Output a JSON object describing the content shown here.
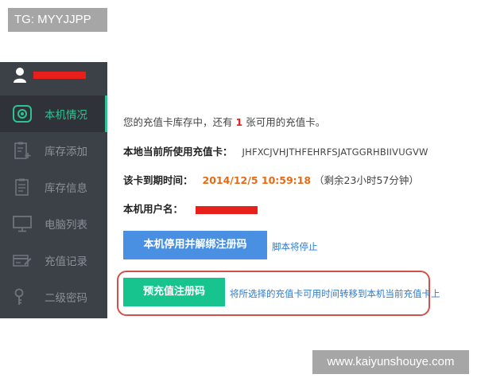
{
  "watermarks": {
    "top_tag": "TG: MYYJJPP",
    "bottom_tag": "www.kaiyunshouye.com"
  },
  "sidebar": {
    "items": [
      {
        "label": "本机情况",
        "icon": "device-icon",
        "active": true
      },
      {
        "label": "库存添加",
        "icon": "clipboard-add-icon",
        "active": false
      },
      {
        "label": "库存信息",
        "icon": "clipboard-list-icon",
        "active": false
      },
      {
        "label": "电脑列表",
        "icon": "monitor-icon",
        "active": false
      },
      {
        "label": "充值记录",
        "icon": "card-edit-icon",
        "active": false
      },
      {
        "label": "二级密码",
        "icon": "key-icon",
        "active": false
      }
    ]
  },
  "main": {
    "inventory_prefix": "您的充值卡库存中，还有",
    "inventory_count": "1",
    "inventory_suffix": "张可用的充值卡。",
    "current_card_label": "本地当前所使用充值卡：",
    "current_card_value": "JHFXCJVHJTHFEHRFSJATGGRHBIIVUGVW",
    "expiry_label": "该卡到期时间：",
    "expiry_value": "2014/12/5 10:59:18",
    "expiry_remaining": "（剩余23小时57分钟）",
    "user_label": "本机用户名："
  },
  "actions": {
    "unbind_button": "本机停用并解绑注册码",
    "unbind_note": "脚本将停止",
    "precharge_button": "预充值注册码",
    "precharge_note": "将所选择的充值卡可用时间转移到本机当前充值卡上"
  },
  "colors": {
    "sidebar_bg": "#3c4047",
    "active_accent": "#2fc391",
    "redaction": "#e8201c",
    "blue_button": "#4a90e2",
    "green_button": "#17c48d",
    "link_blue": "#2b7bd6",
    "highlight_border": "#d2504a"
  }
}
